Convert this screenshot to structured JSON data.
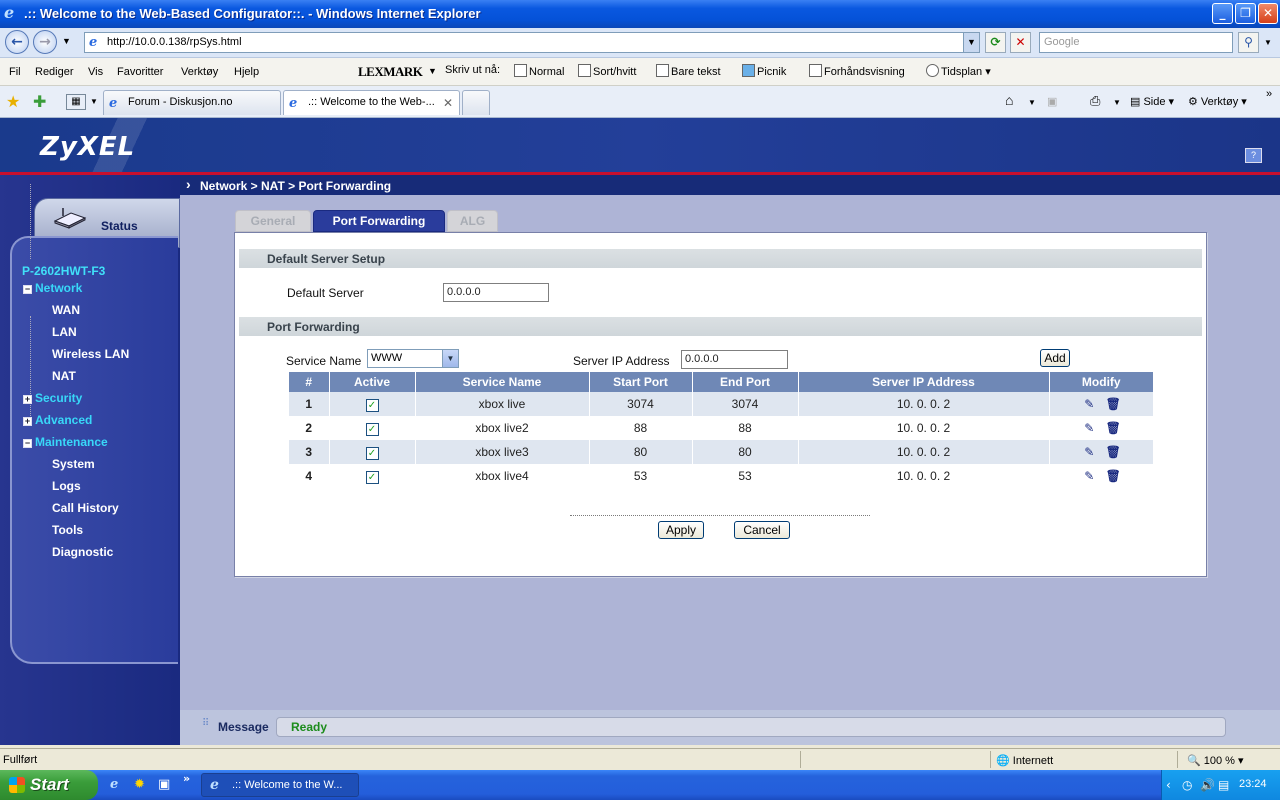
{
  "window": {
    "title": ".:: Welcome to the Web-Based Configurator::. - Windows Internet Explorer"
  },
  "address": {
    "url": "http://10.0.0.138/rpSys.html",
    "search_placeholder": "Google"
  },
  "menu": {
    "items": [
      "Fil",
      "Rediger",
      "Vis",
      "Favoritter",
      "Verktøy",
      "Hjelp"
    ]
  },
  "toolbar": {
    "brand": "LEXMARK",
    "print_label": "Skriv ut nå:",
    "items": [
      "Normal",
      "Sort/hvitt",
      "Bare tekst",
      "Picnik",
      "Forhåndsvisning",
      "Tidsplan"
    ]
  },
  "browser_tabs": [
    {
      "label": "Forum - Diskusjon.no"
    },
    {
      "label": ".:: Welcome to the Web-..."
    }
  ],
  "right_toolbar": {
    "page": "Side",
    "tools": "Verktøy"
  },
  "router": {
    "logo": "ZyXEL",
    "breadcrumb": "Network > NAT > Port Forwarding",
    "status_label": "Status",
    "model": "P-2602HWT-F3",
    "nav": {
      "network": "Network",
      "wan": "WAN",
      "lan": "LAN",
      "wireless_lan": "Wireless LAN",
      "nat": "NAT",
      "security": "Security",
      "advanced": "Advanced",
      "maintenance": "Maintenance",
      "system": "System",
      "logs": "Logs",
      "call_history": "Call History",
      "tools": "Tools",
      "diagnostic": "Diagnostic"
    },
    "tabs": {
      "general": "General",
      "port_forwarding": "Port Forwarding",
      "alg": "ALG"
    },
    "default_server": {
      "section_title": "Default Server Setup",
      "label": "Default Server",
      "value": "0.0.0.0"
    },
    "port_forwarding": {
      "section_title": "Port Forwarding",
      "service_name_label": "Service Name",
      "service_name_value": "WWW",
      "server_ip_label": "Server IP Address",
      "server_ip_value": "0.0.0.0",
      "add_label": "Add",
      "columns": [
        "#",
        "Active",
        "Service Name",
        "Start Port",
        "End Port",
        "Server IP Address",
        "Modify"
      ],
      "rows": [
        {
          "num": "1",
          "active": true,
          "service": "xbox live",
          "start": "3074",
          "end": "3074",
          "ip": "10. 0. 0. 2"
        },
        {
          "num": "2",
          "active": true,
          "service": "xbox live2",
          "start": "88",
          "end": "88",
          "ip": "10. 0. 0. 2"
        },
        {
          "num": "3",
          "active": true,
          "service": "xbox live3",
          "start": "80",
          "end": "80",
          "ip": "10. 0. 0. 2"
        },
        {
          "num": "4",
          "active": true,
          "service": "xbox live4",
          "start": "53",
          "end": "53",
          "ip": "10. 0. 0. 2"
        }
      ]
    },
    "buttons": {
      "apply": "Apply",
      "cancel": "Cancel"
    },
    "message": {
      "label": "Message",
      "text": "Ready"
    }
  },
  "statusbar": {
    "left": "Fullført",
    "zone": "Internett",
    "zoom": "100 %"
  },
  "taskbar": {
    "start": "Start",
    "item": ".:: Welcome to the W...",
    "time": "23:24"
  }
}
